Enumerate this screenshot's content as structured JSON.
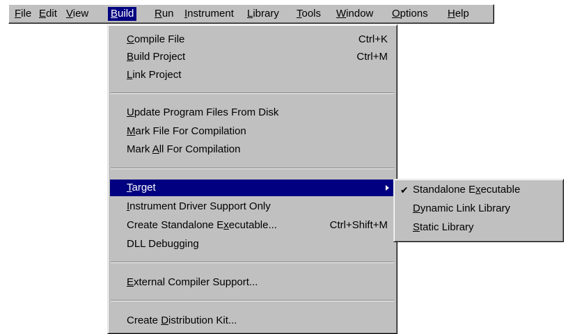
{
  "menubar": {
    "items": [
      {
        "pre": "",
        "key": "F",
        "post": "ile"
      },
      {
        "pre": "",
        "key": "E",
        "post": "dit"
      },
      {
        "pre": "",
        "key": "V",
        "post": "iew"
      },
      {
        "pre": "",
        "key": "B",
        "post": "uild"
      },
      {
        "pre": "",
        "key": "R",
        "post": "un"
      },
      {
        "pre": "",
        "key": "I",
        "post": "nstrument"
      },
      {
        "pre": "",
        "key": "L",
        "post": "ibrary"
      },
      {
        "pre": "",
        "key": "T",
        "post": "ools"
      },
      {
        "pre": "",
        "key": "W",
        "post": "indow"
      },
      {
        "pre": "",
        "key": "O",
        "post": "ptions"
      },
      {
        "pre": "",
        "key": "H",
        "post": "elp"
      }
    ],
    "active": "Build"
  },
  "build_menu": {
    "items": [
      {
        "pre": "",
        "key": "C",
        "post": "ompile File",
        "shortcut": "Ctrl+K"
      },
      {
        "pre": "",
        "key": "B",
        "post": "uild Project",
        "shortcut": "Ctrl+M"
      },
      {
        "pre": "",
        "key": "L",
        "post": "ink Project",
        "shortcut": ""
      },
      {
        "pre": "",
        "key": "U",
        "post": "pdate Program Files From Disk",
        "shortcut": ""
      },
      {
        "pre": "",
        "key": "M",
        "post": "ark File For Compilation",
        "shortcut": ""
      },
      {
        "pre": "Mark ",
        "key": "A",
        "post": "ll For Compilation",
        "shortcut": ""
      },
      {
        "pre": "",
        "key": "T",
        "post": "arget",
        "shortcut": ""
      },
      {
        "pre": "",
        "key": "I",
        "post": "nstrument Driver Support Only",
        "shortcut": ""
      },
      {
        "pre": "Create Standalone E",
        "key": "x",
        "post": "ecutable...",
        "shortcut": "Ctrl+Shift+M"
      },
      {
        "pre": "DLL Debugging",
        "key": "",
        "post": "",
        "shortcut": ""
      },
      {
        "pre": "",
        "key": "E",
        "post": "xternal Compiler Support...",
        "shortcut": ""
      },
      {
        "pre": "Create ",
        "key": "D",
        "post": "istribution Kit...",
        "shortcut": ""
      }
    ],
    "highlighted": "Target"
  },
  "target_submenu": {
    "items": [
      {
        "pre": "Standalone E",
        "key": "x",
        "post": "ecutable",
        "checked": true
      },
      {
        "pre": "",
        "key": "D",
        "post": "ynamic Link Library",
        "checked": false
      },
      {
        "pre": "",
        "key": "S",
        "post": "tatic Library",
        "checked": false
      }
    ],
    "check_glyph": "✔"
  },
  "colors": {
    "menu_face": "#c0c0c0",
    "highlight": "#000080",
    "highlight_text": "#ffffff"
  }
}
